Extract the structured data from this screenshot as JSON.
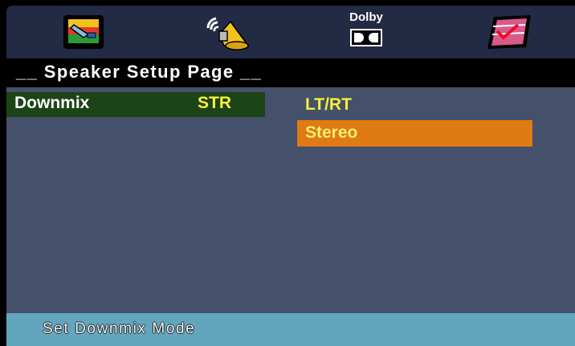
{
  "icons": {
    "general": "tv-setup-icon",
    "speaker": "speaker-icon",
    "dolby": "dolby-icon",
    "preference": "preference-icon",
    "dolby_text": "Dolby"
  },
  "header": {
    "title": "__ Speaker Setup Page __"
  },
  "menu": {
    "label": "Downmix",
    "value": "STR"
  },
  "options": [
    "LT/RT",
    "Stereo"
  ],
  "selected_option": "Stereo",
  "status": {
    "text": "Set Downmix Mode"
  },
  "colors": {
    "screen_bg": "#45506a",
    "icon_bar": "#232a44",
    "menu_selected": "#1d4318",
    "option_highlight": "#e07a12",
    "value_text": "#f5f03a",
    "status_bar": "#61a6bc"
  }
}
